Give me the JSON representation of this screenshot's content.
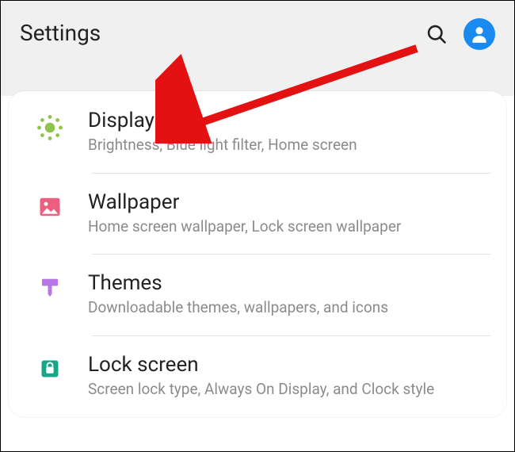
{
  "header": {
    "title": "Settings"
  },
  "items": [
    {
      "title": "Display",
      "desc": "Brightness, Blue light filter, Home screen",
      "icon": "sun",
      "icon_color": "#8fc44a"
    },
    {
      "title": "Wallpaper",
      "desc": "Home screen wallpaper, Lock screen wallpaper",
      "icon": "picture",
      "icon_color": "#ec5f80"
    },
    {
      "title": "Themes",
      "desc": "Downloadable themes, wallpapers, and icons",
      "icon": "brush",
      "icon_color": "#b775e6"
    },
    {
      "title": "Lock screen",
      "desc": "Screen lock type, Always On Display, and Clock style",
      "icon": "lock",
      "icon_color": "#16a68a"
    }
  ],
  "colors": {
    "avatar_bg": "#1a89f0",
    "arrow": "#e31111"
  }
}
